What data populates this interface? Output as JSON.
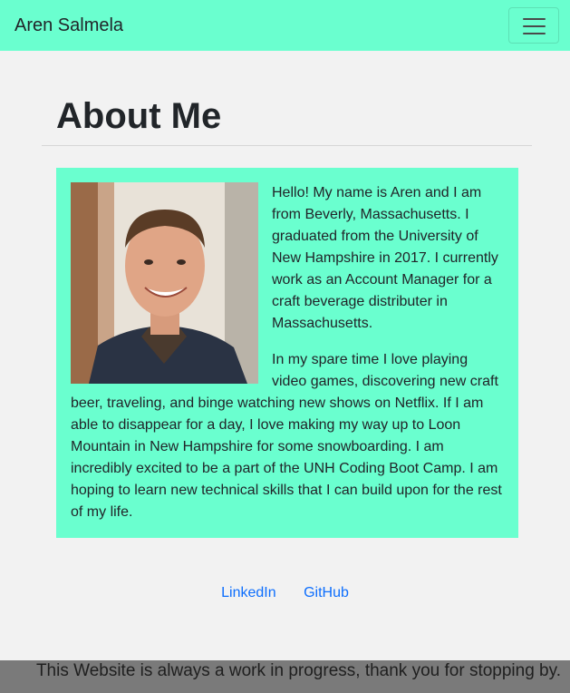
{
  "navbar": {
    "brand": "Aren Salmela",
    "toggle_icon": "hamburger-menu-icon"
  },
  "main": {
    "title": "About Me",
    "paragraphs": [
      "Hello! My name is Aren and I am from Beverly, Massachusetts. I graduated from the University of New Hampshire in 2017. I currently work as an Account Manager for a craft beverage distributer in Massachusetts.",
      "In my spare time I love playing video games, discovering new craft beer, traveling, and binge watching new shows on Netflix. If I am able to disappear for a day, I love making my way up to Loon Mountain in New Hampshire for some snowboarding. I am incredibly excited to be a part of the UNH Coding Boot Camp. I am hoping to learn new technical skills that I can build upon for the rest of my life."
    ]
  },
  "links": {
    "linkedin": "LinkedIn",
    "github": "GitHub"
  },
  "footer": {
    "text": "This Website is always a work in progress, thank you for stopping by."
  },
  "colors": {
    "accent": "#6affcf",
    "link": "#0d6efd",
    "footer_bg": "#7a7a7a"
  }
}
